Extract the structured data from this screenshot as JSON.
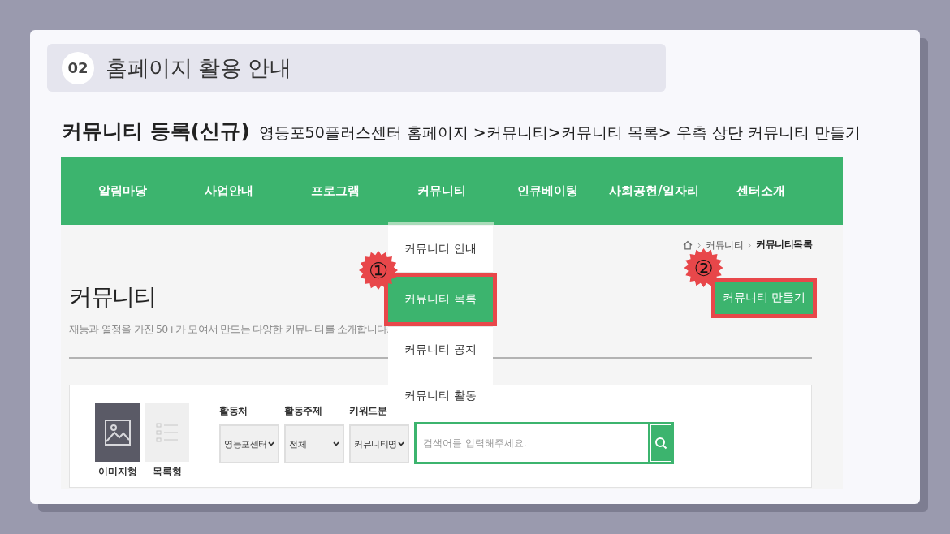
{
  "header": {
    "number": "02",
    "title": "홈페이지 활용 안내"
  },
  "instruction": {
    "heading": "커뮤니티 등록(신규)",
    "text": "영등포50플러스센터 홈페이지 >커뮤니티>커뮤니티 목록> 우측 상단 커뮤니티 만들기"
  },
  "screenshot": {
    "nav": [
      {
        "label": "알림마당",
        "selected": false
      },
      {
        "label": "사업안내",
        "selected": false
      },
      {
        "label": "프로그램",
        "selected": false
      },
      {
        "label": "커뮤니티",
        "selected": true
      },
      {
        "label": "인큐베이팅",
        "selected": false
      },
      {
        "label": "사회공헌/일자리",
        "selected": false
      },
      {
        "label": "센터소개",
        "selected": false
      }
    ],
    "dropdown": [
      {
        "label": "커뮤니티 안내",
        "selected": false
      },
      {
        "label": "커뮤니티 목록",
        "selected": true,
        "callout": "①"
      },
      {
        "label": "커뮤니티 공지",
        "selected": false
      },
      {
        "label": "커뮤니티 활동",
        "selected": false
      }
    ],
    "breadcrumb": [
      {
        "label": "커뮤니티",
        "current": false
      },
      {
        "label": "커뮤니티목록",
        "current": true
      }
    ],
    "page_title": "커뮤니티",
    "page_description": "재능과 열정을 가진 50+가 모여서 만드는 다양한 커뮤니티를 소개합니다.",
    "create_button": {
      "label": "커뮤니티 만들기",
      "callout": "②"
    },
    "view_modes": [
      {
        "kind": "image",
        "label": "이미지형",
        "selected": true
      },
      {
        "kind": "list",
        "label": "목록형",
        "selected": false
      }
    ],
    "filters": [
      {
        "label": "활동처",
        "value": "영등포센터"
      },
      {
        "label": "활동주제",
        "value": "전체"
      },
      {
        "label": "키워드분",
        "value": "커뮤니티명"
      }
    ],
    "search": {
      "placeholder": "검색어를 입력해주세요."
    }
  }
}
